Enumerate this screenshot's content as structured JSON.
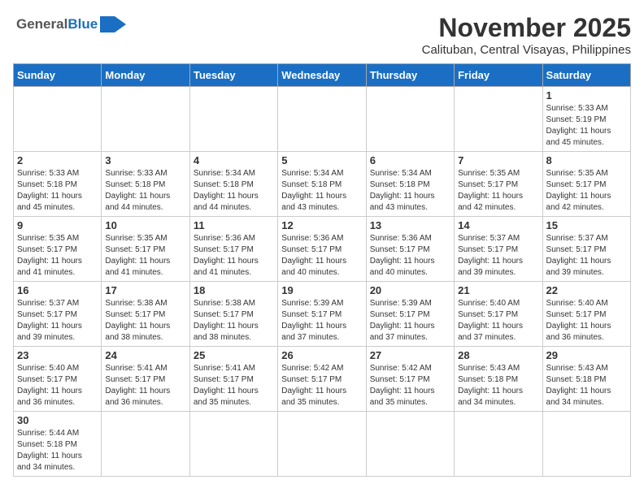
{
  "header": {
    "logo_general": "General",
    "logo_blue": "Blue",
    "title": "November 2025",
    "subtitle": "Calituban, Central Visayas, Philippines"
  },
  "weekdays": [
    "Sunday",
    "Monday",
    "Tuesday",
    "Wednesday",
    "Thursday",
    "Friday",
    "Saturday"
  ],
  "weeks": [
    [
      {
        "day": "",
        "info": ""
      },
      {
        "day": "",
        "info": ""
      },
      {
        "day": "",
        "info": ""
      },
      {
        "day": "",
        "info": ""
      },
      {
        "day": "",
        "info": ""
      },
      {
        "day": "",
        "info": ""
      },
      {
        "day": "1",
        "info": "Sunrise: 5:33 AM\nSunset: 5:19 PM\nDaylight: 11 hours\nand 45 minutes."
      }
    ],
    [
      {
        "day": "2",
        "info": "Sunrise: 5:33 AM\nSunset: 5:18 PM\nDaylight: 11 hours\nand 45 minutes."
      },
      {
        "day": "3",
        "info": "Sunrise: 5:33 AM\nSunset: 5:18 PM\nDaylight: 11 hours\nand 44 minutes."
      },
      {
        "day": "4",
        "info": "Sunrise: 5:34 AM\nSunset: 5:18 PM\nDaylight: 11 hours\nand 44 minutes."
      },
      {
        "day": "5",
        "info": "Sunrise: 5:34 AM\nSunset: 5:18 PM\nDaylight: 11 hours\nand 43 minutes."
      },
      {
        "day": "6",
        "info": "Sunrise: 5:34 AM\nSunset: 5:18 PM\nDaylight: 11 hours\nand 43 minutes."
      },
      {
        "day": "7",
        "info": "Sunrise: 5:35 AM\nSunset: 5:17 PM\nDaylight: 11 hours\nand 42 minutes."
      },
      {
        "day": "8",
        "info": "Sunrise: 5:35 AM\nSunset: 5:17 PM\nDaylight: 11 hours\nand 42 minutes."
      }
    ],
    [
      {
        "day": "9",
        "info": "Sunrise: 5:35 AM\nSunset: 5:17 PM\nDaylight: 11 hours\nand 41 minutes."
      },
      {
        "day": "10",
        "info": "Sunrise: 5:35 AM\nSunset: 5:17 PM\nDaylight: 11 hours\nand 41 minutes."
      },
      {
        "day": "11",
        "info": "Sunrise: 5:36 AM\nSunset: 5:17 PM\nDaylight: 11 hours\nand 41 minutes."
      },
      {
        "day": "12",
        "info": "Sunrise: 5:36 AM\nSunset: 5:17 PM\nDaylight: 11 hours\nand 40 minutes."
      },
      {
        "day": "13",
        "info": "Sunrise: 5:36 AM\nSunset: 5:17 PM\nDaylight: 11 hours\nand 40 minutes."
      },
      {
        "day": "14",
        "info": "Sunrise: 5:37 AM\nSunset: 5:17 PM\nDaylight: 11 hours\nand 39 minutes."
      },
      {
        "day": "15",
        "info": "Sunrise: 5:37 AM\nSunset: 5:17 PM\nDaylight: 11 hours\nand 39 minutes."
      }
    ],
    [
      {
        "day": "16",
        "info": "Sunrise: 5:37 AM\nSunset: 5:17 PM\nDaylight: 11 hours\nand 39 minutes."
      },
      {
        "day": "17",
        "info": "Sunrise: 5:38 AM\nSunset: 5:17 PM\nDaylight: 11 hours\nand 38 minutes."
      },
      {
        "day": "18",
        "info": "Sunrise: 5:38 AM\nSunset: 5:17 PM\nDaylight: 11 hours\nand 38 minutes."
      },
      {
        "day": "19",
        "info": "Sunrise: 5:39 AM\nSunset: 5:17 PM\nDaylight: 11 hours\nand 37 minutes."
      },
      {
        "day": "20",
        "info": "Sunrise: 5:39 AM\nSunset: 5:17 PM\nDaylight: 11 hours\nand 37 minutes."
      },
      {
        "day": "21",
        "info": "Sunrise: 5:40 AM\nSunset: 5:17 PM\nDaylight: 11 hours\nand 37 minutes."
      },
      {
        "day": "22",
        "info": "Sunrise: 5:40 AM\nSunset: 5:17 PM\nDaylight: 11 hours\nand 36 minutes."
      }
    ],
    [
      {
        "day": "23",
        "info": "Sunrise: 5:40 AM\nSunset: 5:17 PM\nDaylight: 11 hours\nand 36 minutes."
      },
      {
        "day": "24",
        "info": "Sunrise: 5:41 AM\nSunset: 5:17 PM\nDaylight: 11 hours\nand 36 minutes."
      },
      {
        "day": "25",
        "info": "Sunrise: 5:41 AM\nSunset: 5:17 PM\nDaylight: 11 hours\nand 35 minutes."
      },
      {
        "day": "26",
        "info": "Sunrise: 5:42 AM\nSunset: 5:17 PM\nDaylight: 11 hours\nand 35 minutes."
      },
      {
        "day": "27",
        "info": "Sunrise: 5:42 AM\nSunset: 5:17 PM\nDaylight: 11 hours\nand 35 minutes."
      },
      {
        "day": "28",
        "info": "Sunrise: 5:43 AM\nSunset: 5:18 PM\nDaylight: 11 hours\nand 34 minutes."
      },
      {
        "day": "29",
        "info": "Sunrise: 5:43 AM\nSunset: 5:18 PM\nDaylight: 11 hours\nand 34 minutes."
      }
    ],
    [
      {
        "day": "30",
        "info": "Sunrise: 5:44 AM\nSunset: 5:18 PM\nDaylight: 11 hours\nand 34 minutes."
      },
      {
        "day": "",
        "info": ""
      },
      {
        "day": "",
        "info": ""
      },
      {
        "day": "",
        "info": ""
      },
      {
        "day": "",
        "info": ""
      },
      {
        "day": "",
        "info": ""
      },
      {
        "day": "",
        "info": ""
      }
    ]
  ]
}
